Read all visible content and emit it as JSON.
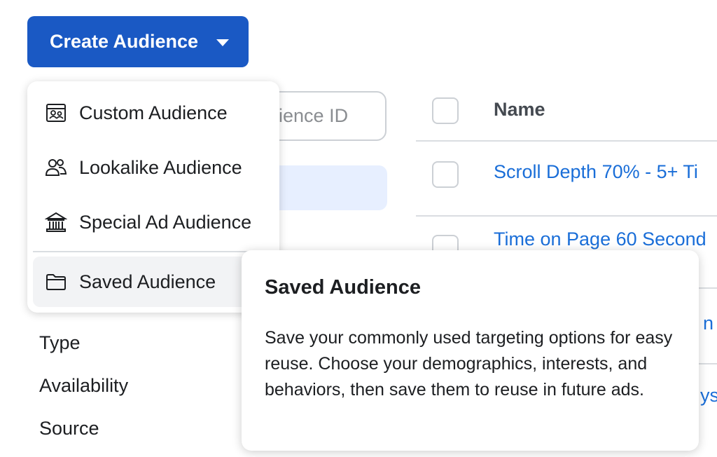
{
  "toolbar": {
    "create_label": "Create Audience"
  },
  "search": {
    "visible_text": "dience ID"
  },
  "menu": {
    "items": [
      {
        "label": "Custom Audience",
        "icon": "custom-audience-icon"
      },
      {
        "label": "Lookalike Audience",
        "icon": "people-icon"
      },
      {
        "label": "Special Ad Audience",
        "icon": "bank-icon"
      },
      {
        "label": "Saved Audience",
        "icon": "folder-icon"
      }
    ]
  },
  "table": {
    "name_header": "Name",
    "rows": [
      {
        "name": "Scroll Depth 70% - 5+ Ti"
      },
      {
        "name": "Time on Page 60 Second"
      }
    ],
    "partial_fragments": [
      "n",
      "ys"
    ]
  },
  "filters": {
    "items": [
      "Type",
      "Availability",
      "Source"
    ]
  },
  "tooltip": {
    "title": "Saved Audience",
    "body": "Save your commonly used targeting options for easy reuse. Choose your demographics, interests, and behaviors, then save them to reuse in future ads."
  },
  "colors": {
    "primary_button": "#1a59c4",
    "link": "#1a6ed8",
    "active_menu_bg": "#f2f3f5"
  }
}
